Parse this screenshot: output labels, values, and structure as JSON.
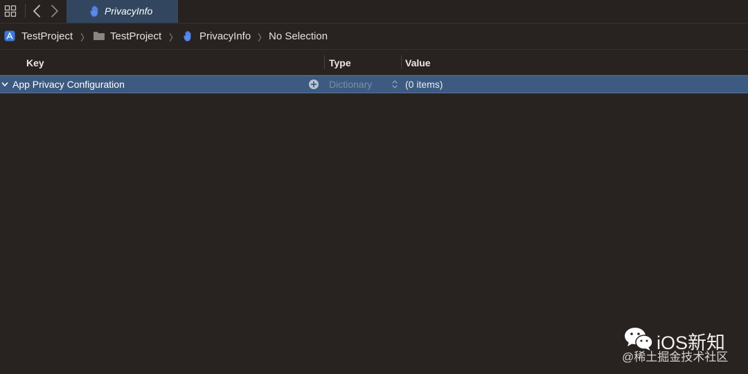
{
  "tabbar": {
    "active_tab": {
      "label": "PrivacyInfo",
      "icon": "hand-raised-icon"
    },
    "icons": {
      "grid": "grid-icon",
      "back": "chevron-left-icon",
      "forward": "chevron-right-icon"
    }
  },
  "jumpbar": {
    "crumbs": [
      {
        "label": "TestProject",
        "icon": "app-project-icon"
      },
      {
        "label": "TestProject",
        "icon": "folder-icon"
      },
      {
        "label": "PrivacyInfo",
        "icon": "hand-raised-icon"
      },
      {
        "label": "No Selection",
        "icon": ""
      }
    ],
    "separator": "〉"
  },
  "table": {
    "headers": {
      "key": "Key",
      "type": "Type",
      "value": "Value"
    },
    "rows": [
      {
        "key": "App Privacy Configuration",
        "type": "Dictionary",
        "value": "(0 items)",
        "expanded": true,
        "selected": true
      }
    ]
  },
  "watermark": {
    "title": "iOS新知",
    "subtitle": "@稀土掘金技术社区",
    "icon": "wechat-icon"
  },
  "colors": {
    "background": "#282220",
    "selection": "#3d5a80",
    "tab_active": "#32475f",
    "accent_icon": "#4a7de0"
  }
}
